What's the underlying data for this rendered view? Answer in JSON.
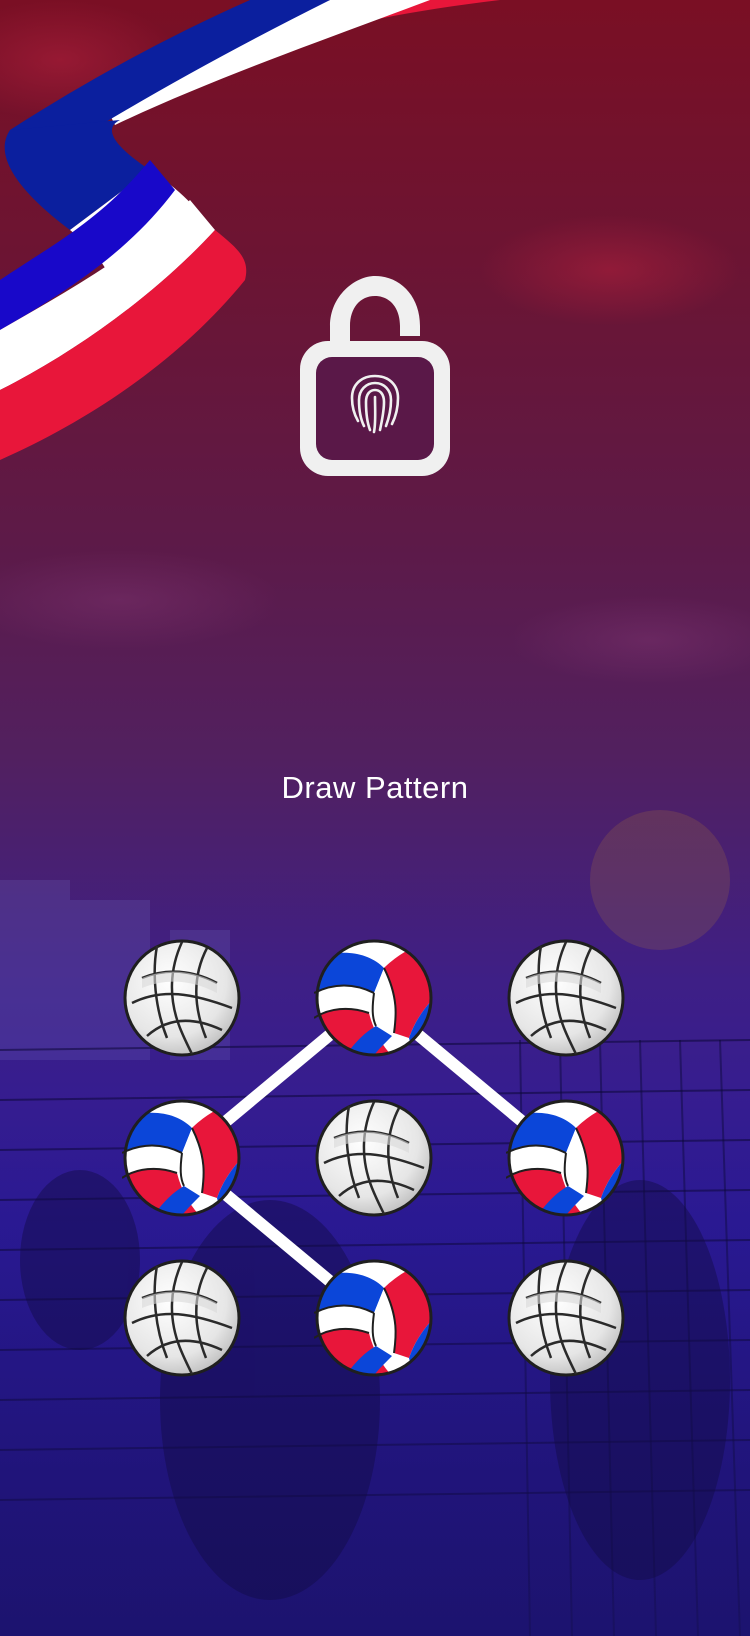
{
  "screen": {
    "title": "Draw Pattern"
  },
  "lock_icon": {
    "name": "unlocked-padlock-fingerprint-icon"
  },
  "decorations": {
    "ribbon_icon": "tricolor-ribbon-icon",
    "background_scene": "volleyball-court-photo"
  },
  "colors": {
    "accent_blue": "#0b46d9",
    "accent_red": "#e8163a",
    "ball_white": "#f2f2f2",
    "line": "#ffffff"
  },
  "pattern": {
    "selected_cells": [
      2,
      4,
      6,
      8
    ],
    "path_order": [
      4,
      2,
      6,
      8,
      4
    ]
  }
}
